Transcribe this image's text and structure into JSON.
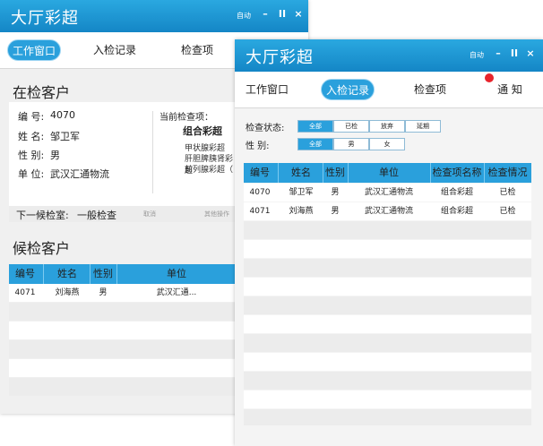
{
  "back_window": {
    "title": "大厅彩超",
    "auto_label": "自动",
    "minimize": "–",
    "pause": "II",
    "close": "×",
    "tabs": [
      "工作窗口",
      "入检记录",
      "检查项"
    ],
    "current_section": "在检客户",
    "fields": [
      {
        "label": "编 号:",
        "value": "4070"
      },
      {
        "label": "姓 名:",
        "value": "邹卫军"
      },
      {
        "label": "性 别:",
        "value": "男"
      },
      {
        "label": "单 位:",
        "value": "武汉汇通物流"
      }
    ],
    "current_item_label": "当前检查项：",
    "current_item": "组合彩超",
    "sub_items": [
      "甲状腺彩超",
      "肝胆脾胰肾彩超",
      "前列腺彩超（"
    ],
    "next_room_label": "下一候检室:",
    "next_room_value": "一般检查",
    "cancel_label": "取消",
    "other_ops_label": "其他操作",
    "waiting_section": "候检客户",
    "columns": [
      "编号",
      "姓名",
      "性别",
      "单位"
    ],
    "rows": [
      {
        "id": "4071",
        "name": "刘海燕",
        "gender": "男",
        "unit": "武汉汇通..."
      }
    ]
  },
  "front_window": {
    "title": "大厅彩超",
    "auto_label": "自动",
    "minimize": "–",
    "pause": "II",
    "close": "×",
    "tabs": [
      "工作窗口",
      "入检记录",
      "检查项",
      "通  知"
    ],
    "status_label": "检查状态:",
    "status_options": [
      "全部",
      "已检",
      "放弃",
      "延期"
    ],
    "gender_label": "性    别:",
    "gender_options": [
      "全部",
      "男",
      "女"
    ],
    "columns": [
      "编号",
      "姓名",
      "性别",
      "单位",
      "检查项名称",
      "检查情况"
    ],
    "rows": [
      {
        "id": "4070",
        "name": "邹卫军",
        "gender": "男",
        "unit": "武汉汇通物流",
        "item": "组合彩超",
        "status": "已检"
      },
      {
        "id": "4071",
        "name": "刘海燕",
        "gender": "男",
        "unit": "武汉汇通物流",
        "item": "组合彩超",
        "status": "已检"
      }
    ]
  },
  "colors": {
    "accent": "#2aa0dc",
    "title_bar": "#1a95d4",
    "notify_dot": "#e8242c"
  }
}
